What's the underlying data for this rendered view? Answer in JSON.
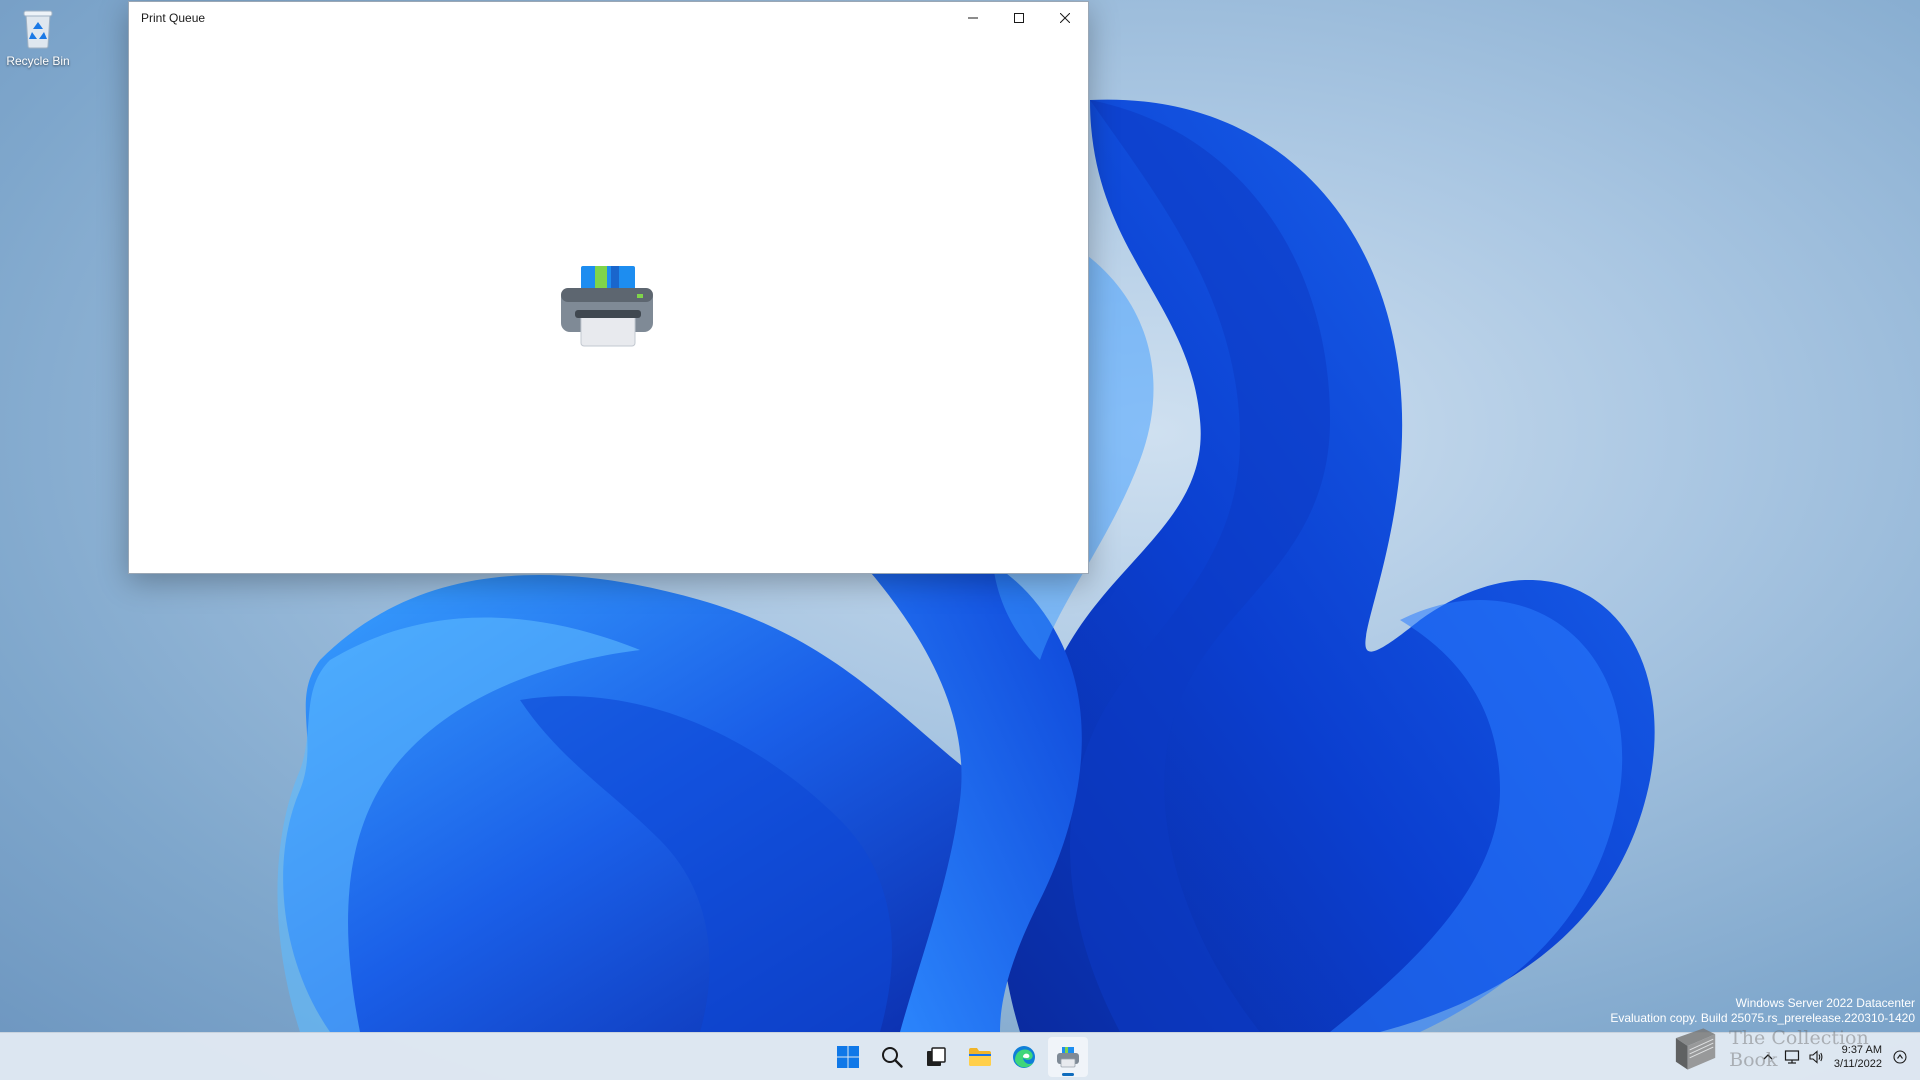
{
  "desktop": {
    "icons": [
      {
        "label": "Recycle Bin",
        "icon": "recycle-bin-icon"
      }
    ],
    "watermark": {
      "line1": "Windows Server 2022 Datacenter",
      "line2": "Evaluation copy. Build 25075.rs_prerelease.220310-1420"
    },
    "overlay_watermark": "The Collection Book"
  },
  "window": {
    "title": "Print Queue",
    "controls": [
      "minimize",
      "maximize",
      "close"
    ],
    "body_icon": "printer-icon"
  },
  "taskbar": {
    "pinned": [
      {
        "name": "Start",
        "icon": "windows-start-icon"
      },
      {
        "name": "Search",
        "icon": "search-icon"
      },
      {
        "name": "Task View",
        "icon": "task-view-icon"
      },
      {
        "name": "File Explorer",
        "icon": "folder-icon"
      },
      {
        "name": "Microsoft Edge",
        "icon": "edge-icon"
      },
      {
        "name": "Print Queue",
        "icon": "printer-icon",
        "active": true
      }
    ],
    "tray": {
      "icons": [
        "chevron-up-icon",
        "network-icon",
        "volume-icon"
      ],
      "time": "9:37 AM",
      "date": "3/11/2022"
    }
  },
  "colors": {
    "accent": "#0f6cbd",
    "wallpaper_blue": "#1a56e8",
    "window_bg": "#ffffff"
  }
}
